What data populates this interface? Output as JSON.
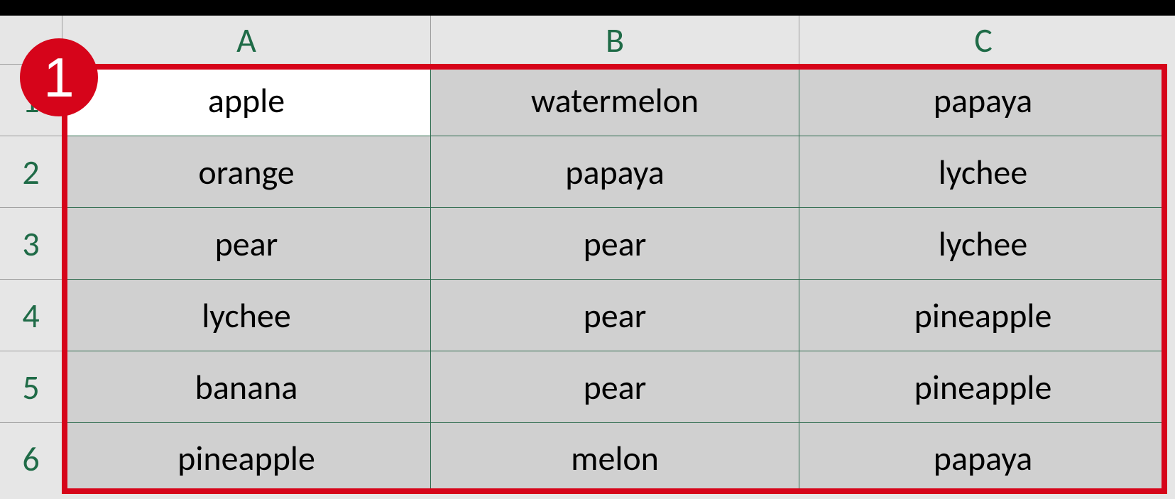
{
  "annotation": {
    "badge_label": "1"
  },
  "columns": [
    "A",
    "B",
    "C"
  ],
  "rows": [
    "1",
    "2",
    "3",
    "4",
    "5",
    "6"
  ],
  "active_cell": {
    "row": 0,
    "col": 0
  },
  "cells": [
    [
      "apple",
      "watermelon",
      "papaya"
    ],
    [
      "orange",
      "papaya",
      "lychee"
    ],
    [
      "pear",
      "pear",
      "lychee"
    ],
    [
      "lychee",
      "pear",
      "pineapple"
    ],
    [
      "banana",
      "pear",
      "pineapple"
    ],
    [
      "pineapple",
      "melon",
      "papaya"
    ]
  ]
}
